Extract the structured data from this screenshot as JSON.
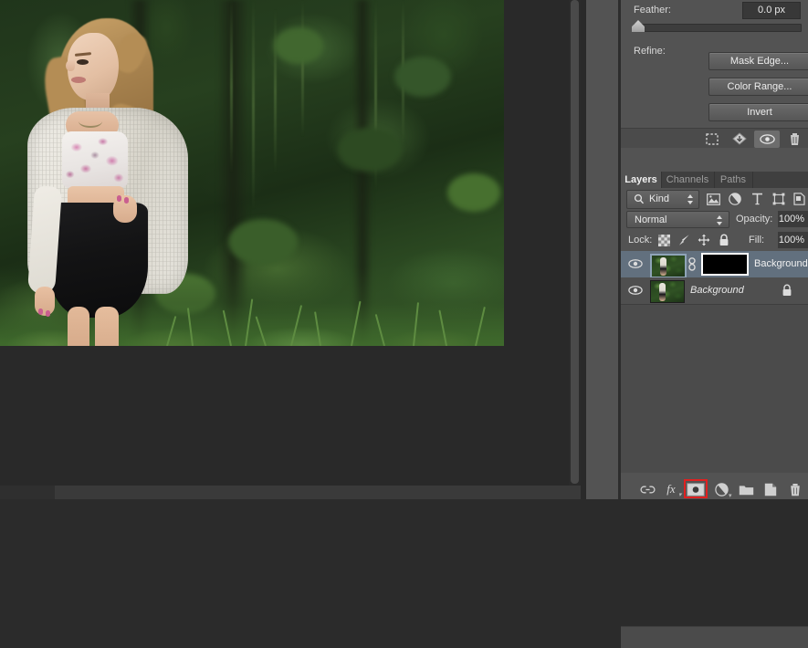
{
  "app": "Adobe Photoshop",
  "properties_panel": {
    "feather": {
      "label": "Feather:",
      "value": "0.0 px"
    },
    "refine": {
      "label": "Refine:"
    },
    "buttons": {
      "mask_edge": "Mask Edge...",
      "color_range": "Color Range...",
      "invert": "Invert"
    },
    "footer_icons": [
      {
        "name": "load-selection-from-mask-icon",
        "glyph": "selection-marching-ants"
      },
      {
        "name": "apply-mask-icon",
        "glyph": "mask-stamp"
      },
      {
        "name": "toggle-mask-visibility-icon",
        "glyph": "eye",
        "active": true
      },
      {
        "name": "delete-mask-icon",
        "glyph": "trash"
      }
    ]
  },
  "layers_panel": {
    "tabs": [
      {
        "label": "Layers",
        "active": true
      },
      {
        "label": "Channels",
        "active": false
      },
      {
        "label": "Paths",
        "active": false
      }
    ],
    "filter": {
      "kind_label": "Kind",
      "icons": [
        "pixel-filter-icon",
        "adjustment-filter-icon",
        "type-filter-icon",
        "shape-filter-icon",
        "smart-object-filter-icon"
      ]
    },
    "blend": {
      "mode": "Normal",
      "opacity_label": "Opacity:",
      "opacity_value": "100%"
    },
    "lock": {
      "label": "Lock:",
      "icons": [
        "lock-transparency-icon",
        "lock-image-pixels-icon",
        "lock-position-icon",
        "lock-all-icon"
      ],
      "fill_label": "Fill:",
      "fill_value": "100%"
    },
    "layers": [
      {
        "name": "Background c...",
        "selected": true,
        "visible": true,
        "has_mask": true,
        "linked": true,
        "locked": false,
        "italic": false
      },
      {
        "name": "Background",
        "selected": false,
        "visible": true,
        "has_mask": false,
        "linked": false,
        "locked": true,
        "italic": true
      }
    ],
    "footer_icons": [
      {
        "name": "link-layers-icon",
        "glyph": "chain",
        "highlighted": false
      },
      {
        "name": "layer-style-fx-icon",
        "glyph": "fx",
        "highlighted": false
      },
      {
        "name": "add-layer-mask-icon",
        "glyph": "mask-circle",
        "highlighted": true
      },
      {
        "name": "new-adjustment-layer-icon",
        "glyph": "half-circle",
        "highlighted": false
      },
      {
        "name": "new-group-icon",
        "glyph": "folder",
        "highlighted": false
      },
      {
        "name": "new-layer-icon",
        "glyph": "page",
        "highlighted": false
      },
      {
        "name": "delete-layer-icon",
        "glyph": "trash",
        "highlighted": false
      }
    ],
    "highlight_color": "#e02020"
  },
  "canvas": {
    "description": "Portrait photograph of a woman in a white knit cardigan, floral crop top and black skater skirt standing in front of dense green foliage"
  },
  "colors": {
    "panel_bg": "#535353",
    "panel_dark": "#4b4b4b",
    "selection_blue": "#62707e",
    "workspace": "#292929",
    "accent_red": "#e02020"
  }
}
